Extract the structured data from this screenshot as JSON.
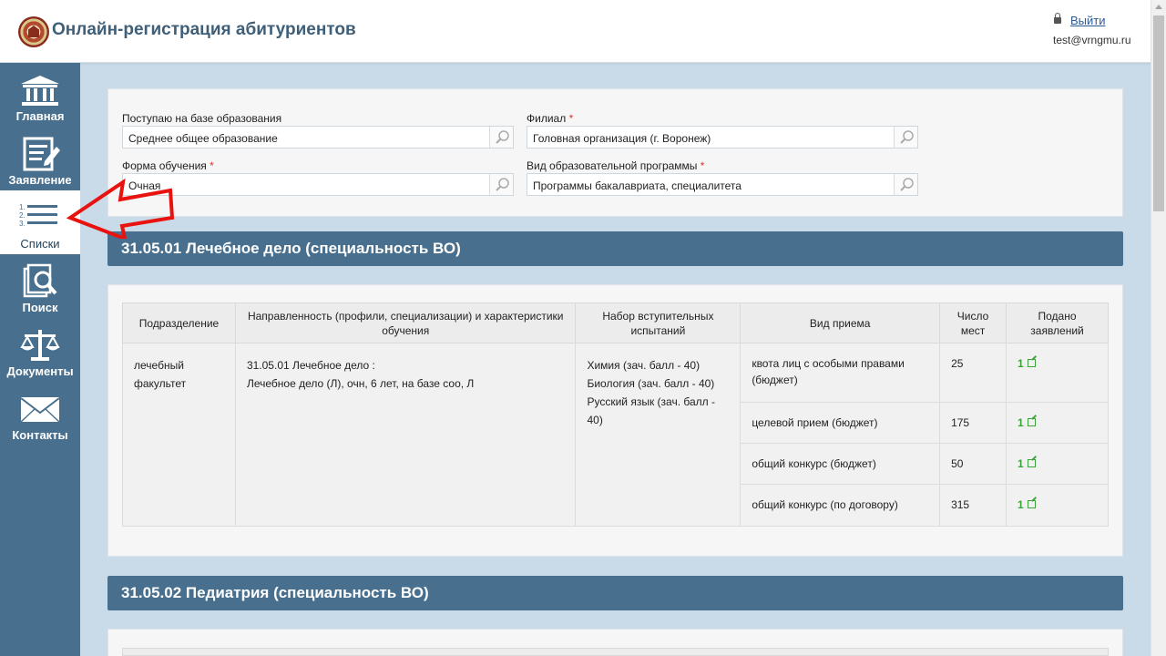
{
  "header": {
    "title": "Онлайн-регистрация абитуриентов",
    "logout_label": "Выйти",
    "user_email": "test@vrngmu.ru"
  },
  "sidebar": {
    "items": [
      {
        "label": "Главная",
        "icon": "bank-icon"
      },
      {
        "label": "Заявление",
        "icon": "form-edit-icon"
      },
      {
        "label": "Списки",
        "icon": "numbered-list-icon",
        "active": true
      },
      {
        "label": "Поиск",
        "icon": "document-search-icon"
      },
      {
        "label": "Документы",
        "icon": "scales-icon"
      },
      {
        "label": "Контакты",
        "icon": "envelope-icon"
      }
    ]
  },
  "filters": {
    "base_education": {
      "label": "Поступаю на базе образования",
      "value": "Среднее общее образование"
    },
    "branch": {
      "label": "Филиал",
      "value": "Головная организация (г. Воронеж)"
    },
    "study_form": {
      "label": "Форма обучения",
      "value": "Очная"
    },
    "program_type": {
      "label": "Вид образовательной программы",
      "value": "Программы бакалавриата, специалитета"
    },
    "required_mark": "*"
  },
  "sections": [
    {
      "title": "31.05.01 Лечебное дело (специальность ВО)"
    },
    {
      "title": "31.05.02 Педиатрия (специальность ВО)"
    }
  ],
  "table": {
    "headers": [
      "Подразделение",
      "Направленность (профили, специализации) и характеристики обучения",
      "Набор вступительных испытаний",
      "Вид приема",
      "Число мест",
      "Подано заявлений"
    ],
    "row": {
      "department": "лечебный факультет",
      "program_line1": "31.05.01 Лечебное дело :",
      "program_line2": "Лечебное дело (Л), очн, 6 лет, на базе соо, Л",
      "exam1": "Химия (зач. балл - 40)",
      "exam2": "Биология (зач. балл - 40)",
      "exam3": "Русский язык (зач. балл - 40)",
      "admissions": [
        {
          "type": "квота лиц с особыми правами (бюджет)",
          "seats": "25",
          "applied": "1"
        },
        {
          "type": "целевой прием (бюджет)",
          "seats": "175",
          "applied": "1"
        },
        {
          "type": "общий конкурс (бюджет)",
          "seats": "50",
          "applied": "1"
        },
        {
          "type": "общий конкурс (по договору)",
          "seats": "315",
          "applied": "1"
        }
      ]
    }
  },
  "colors": {
    "sidebar": "#48708e",
    "section_bar": "#48708e",
    "background": "#c9dbe8",
    "link_green": "#3aa33a",
    "arrow_red": "#e8130f"
  }
}
